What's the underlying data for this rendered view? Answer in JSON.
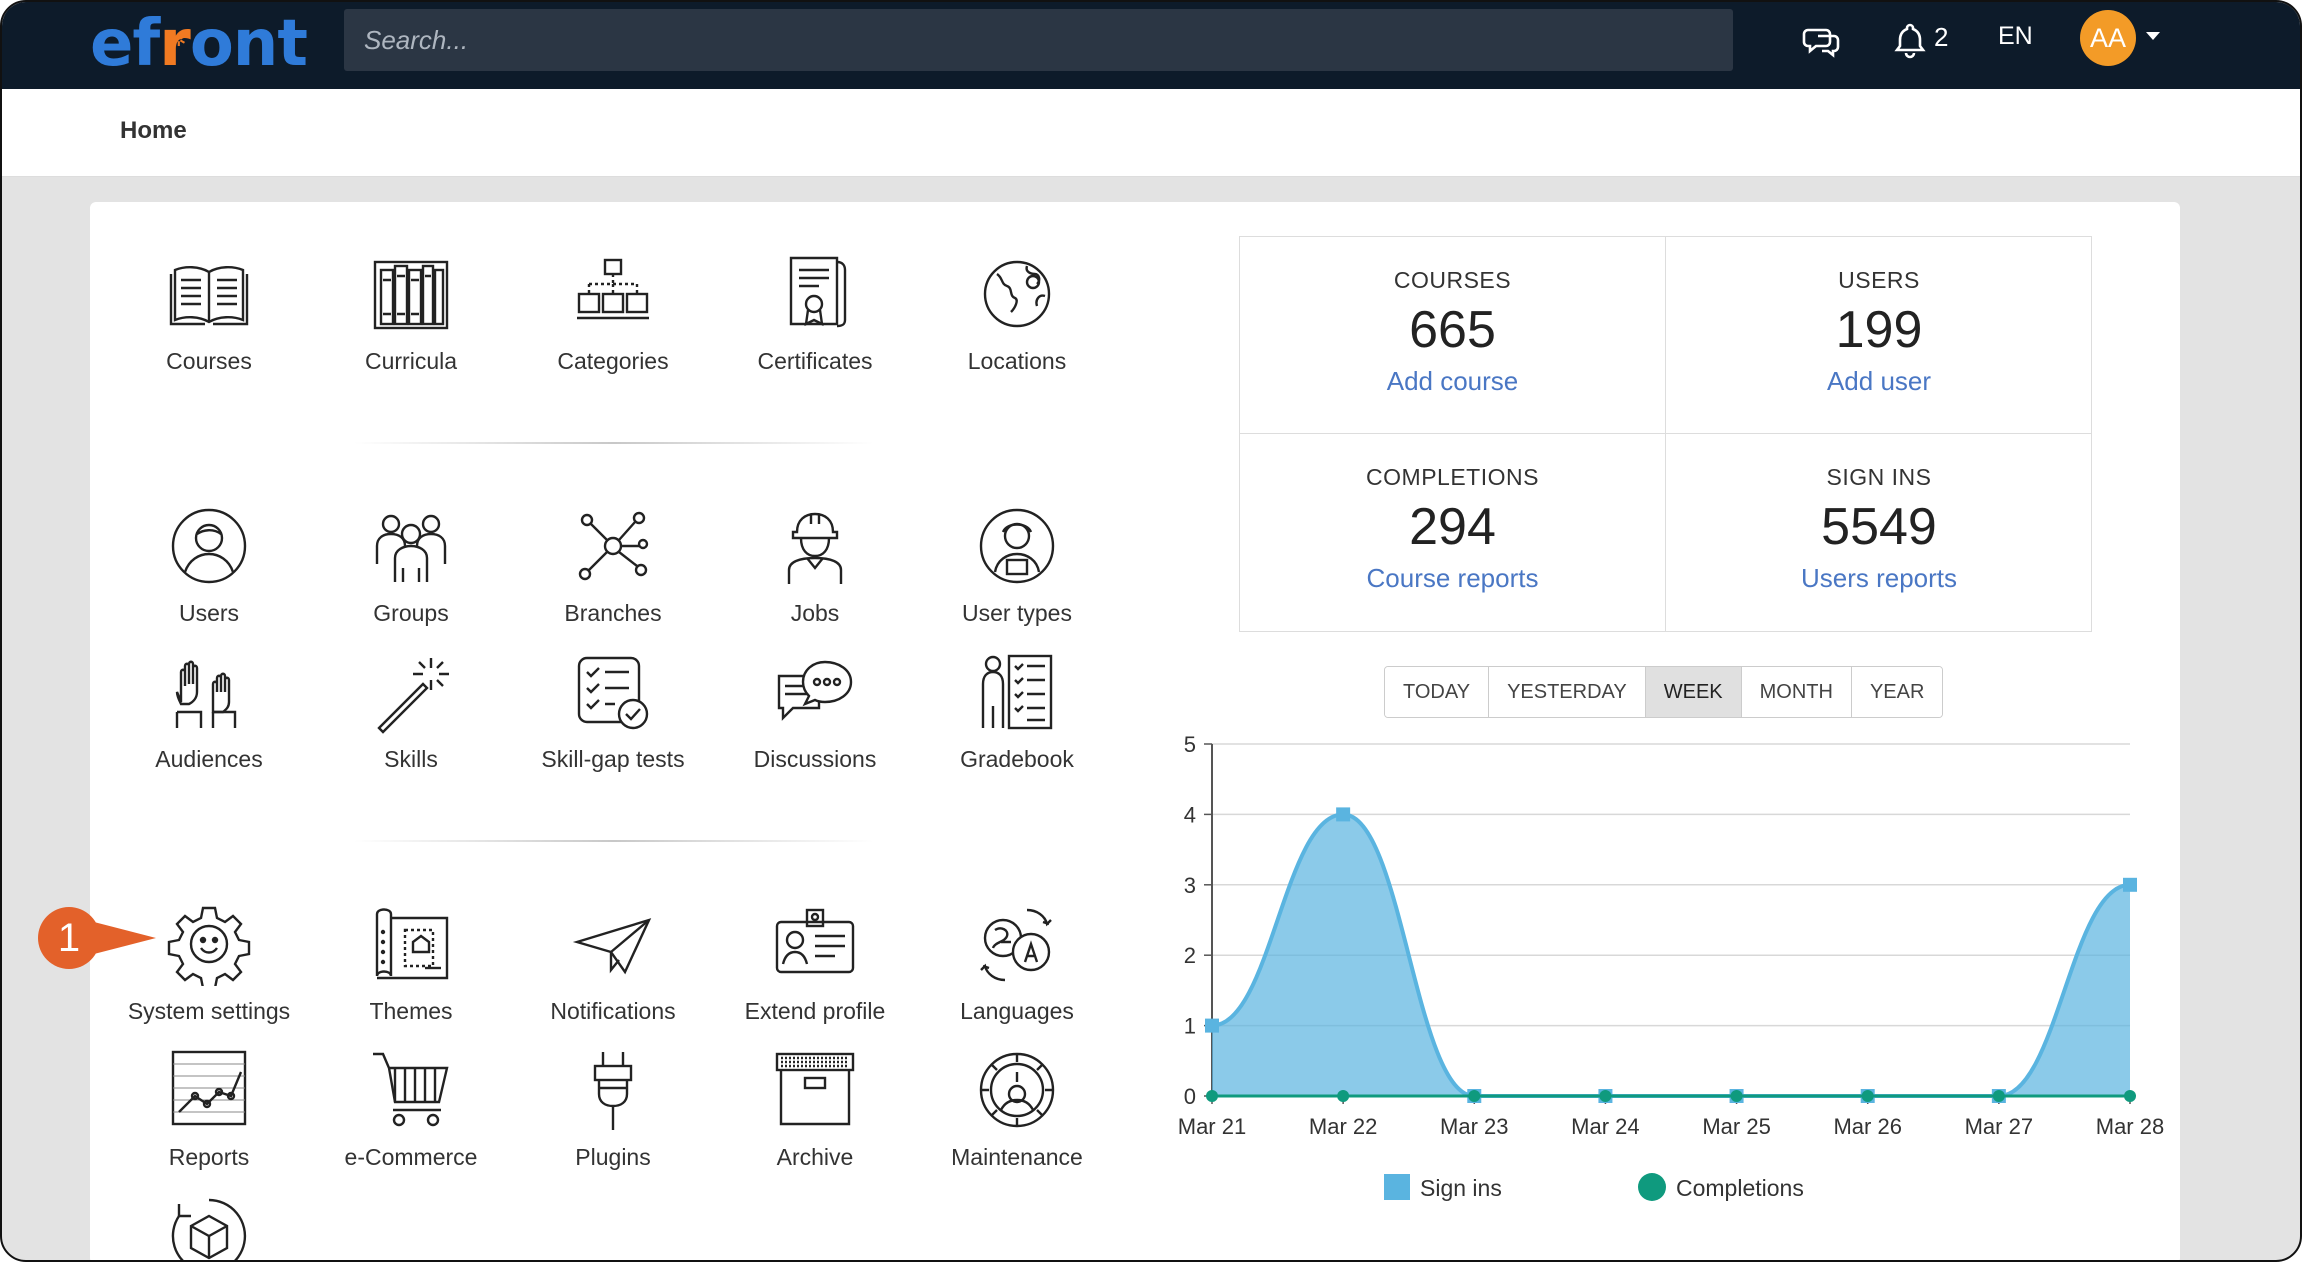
{
  "header": {
    "logo": "efront",
    "search_placeholder": "Search...",
    "notification_count": "2",
    "language": "EN",
    "avatar_initials": "AA"
  },
  "breadcrumb": {
    "home": "Home"
  },
  "tiles": {
    "courses": "Courses",
    "curricula": "Curricula",
    "categories": "Categories",
    "certificates": "Certificates",
    "locations": "Locations",
    "users": "Users",
    "groups": "Groups",
    "branches": "Branches",
    "jobs": "Jobs",
    "user_types": "User types",
    "audiences": "Audiences",
    "skills": "Skills",
    "skill_gap_tests": "Skill-gap tests",
    "discussions": "Discussions",
    "gradebook": "Gradebook",
    "system_settings": "System settings",
    "themes": "Themes",
    "notifications": "Notifications",
    "extend_profile": "Extend profile",
    "languages": "Languages",
    "reports": "Reports",
    "ecommerce": "e-Commerce",
    "plugins": "Plugins",
    "archive": "Archive",
    "maintenance": "Maintenance"
  },
  "stats": {
    "courses": {
      "title": "COURSES",
      "value": "665",
      "action": "Add course"
    },
    "users": {
      "title": "USERS",
      "value": "199",
      "action": "Add user"
    },
    "completions": {
      "title": "COMPLETIONS",
      "value": "294",
      "action": "Course reports"
    },
    "signins": {
      "title": "SIGN INS",
      "value": "5549",
      "action": "Users reports"
    }
  },
  "periods": {
    "today": "TODAY",
    "yesterday": "YESTERDAY",
    "week": "WEEK",
    "month": "MONTH",
    "year": "YEAR",
    "selected": "WEEK"
  },
  "annotation": {
    "step": "1"
  },
  "colors": {
    "topbar": "#0d1b2a",
    "logo_blue": "#2f7bd9",
    "logo_orange": "#f07a22",
    "link": "#4a77c4",
    "signins": "#5ab4e0",
    "completions": "#0f9a7e",
    "badge": "#e3612a"
  },
  "chart_data": {
    "type": "area",
    "x": [
      "Mar 21",
      "Mar 22",
      "Mar 23",
      "Mar 24",
      "Mar 25",
      "Mar 26",
      "Mar 27",
      "Mar 28"
    ],
    "series": [
      {
        "name": "Sign ins",
        "values": [
          1,
          4,
          0,
          0,
          0,
          0,
          0,
          3
        ]
      },
      {
        "name": "Completions",
        "values": [
          0,
          0,
          0,
          0,
          0,
          0,
          0,
          0
        ]
      }
    ],
    "ylim": [
      0,
      5
    ],
    "yticks": [
      "0",
      "1",
      "2",
      "3",
      "4",
      "5"
    ],
    "grid": true,
    "legend": "bottom"
  }
}
